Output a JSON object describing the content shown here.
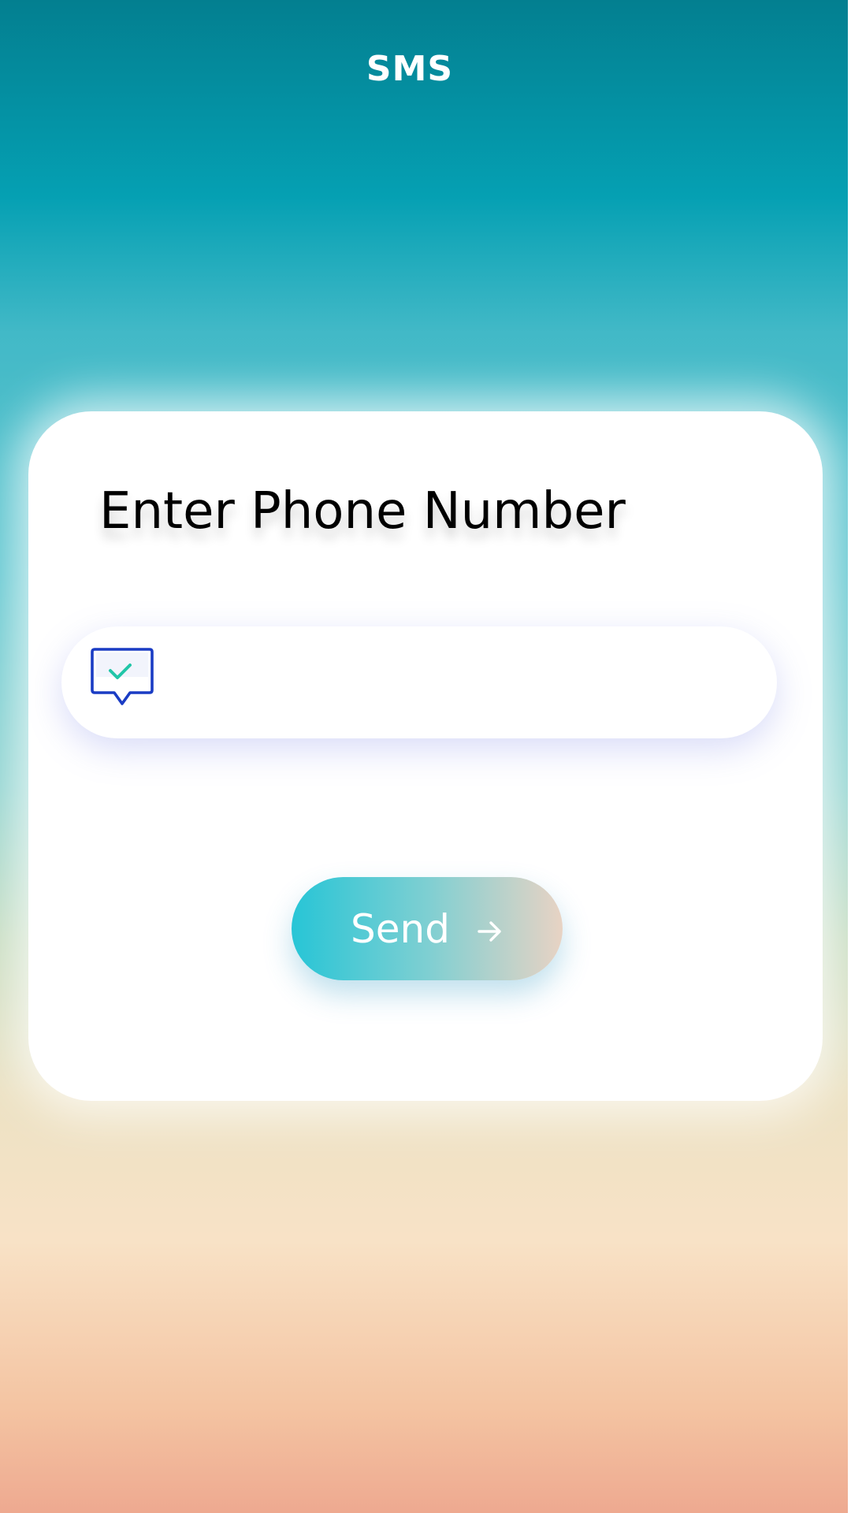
{
  "header": {
    "title": "SMS"
  },
  "card": {
    "heading": "Enter Phone Number",
    "phone_input": {
      "value": "",
      "placeholder": ""
    },
    "send_label": "Send"
  },
  "icons": {
    "input_icon": "message-check-icon",
    "send_icon": "arrow-right-icon"
  },
  "colors": {
    "icon_outline": "#1a3cc4",
    "icon_check": "#22c6a8",
    "button_start": "#27c5d6",
    "button_end": "#e8d3c4"
  }
}
